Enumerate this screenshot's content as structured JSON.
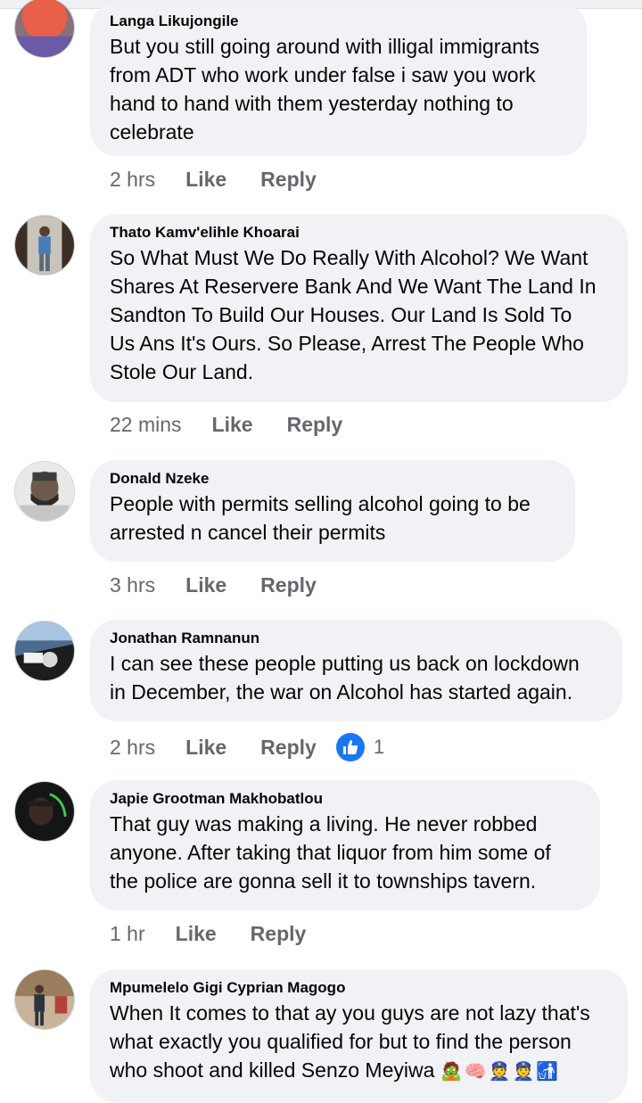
{
  "comments": [
    {
      "author": "Langa Likujongile",
      "text": "But you still going around with illigal immigrants\nfrom ADT who work under false  i saw you work\nhand to hand with them  yesterday nothing to\ncelebrate",
      "time": "2 hrs",
      "like_label": "Like",
      "reply_label": "Reply"
    },
    {
      "author": "Thato Kamv'elihle Khoarai",
      "text": "So What Must We Do Really With Alcohol? We Want\nShares At Reservere Bank And We Want The Land In\nSandton To Build Our Houses. Our Land Is Sold To\nUs Ans It's Ours. So Please, Arrest The People Who\nStole Our Land.",
      "time": "22 mins",
      "like_label": "Like",
      "reply_label": "Reply"
    },
    {
      "author": "Donald Nzeke",
      "text": "People with permits selling alcohol going to be\narrested n cancel their permits",
      "time": "3 hrs",
      "like_label": "Like",
      "reply_label": "Reply"
    },
    {
      "author": "Jonathan Ramnanun",
      "text": "I can see these people putting us back on lockdown\nin December, the war on Alcohol has started again.",
      "time": "2 hrs",
      "like_label": "Like",
      "reply_label": "Reply",
      "reaction_count": "1",
      "reaction_icon": "thumbs-up-icon"
    },
    {
      "author": "Japie Grootman Makhobatlou",
      "text": "That guy was making a living. He never robbed\nanyone. After taking that liquor from him some of\nthe police are gonna sell it to townships tavern.",
      "time": "1 hr",
      "like_label": "Like",
      "reply_label": "Reply"
    },
    {
      "author": "Mpumelelo Gigi Cyprian Magogo",
      "text_lines": [
        "When It comes to that ay you guys are not lazy that's",
        "what exactly you qualified for but to find the person",
        "who shoot and killed Senzo Meyiwa"
      ],
      "emojis": "🧟🧠👮👮🚮"
    }
  ],
  "colors": {
    "bubble_bg": "#f0f2f5",
    "meta_text": "#65676b",
    "like_blue": "#1877f2"
  }
}
